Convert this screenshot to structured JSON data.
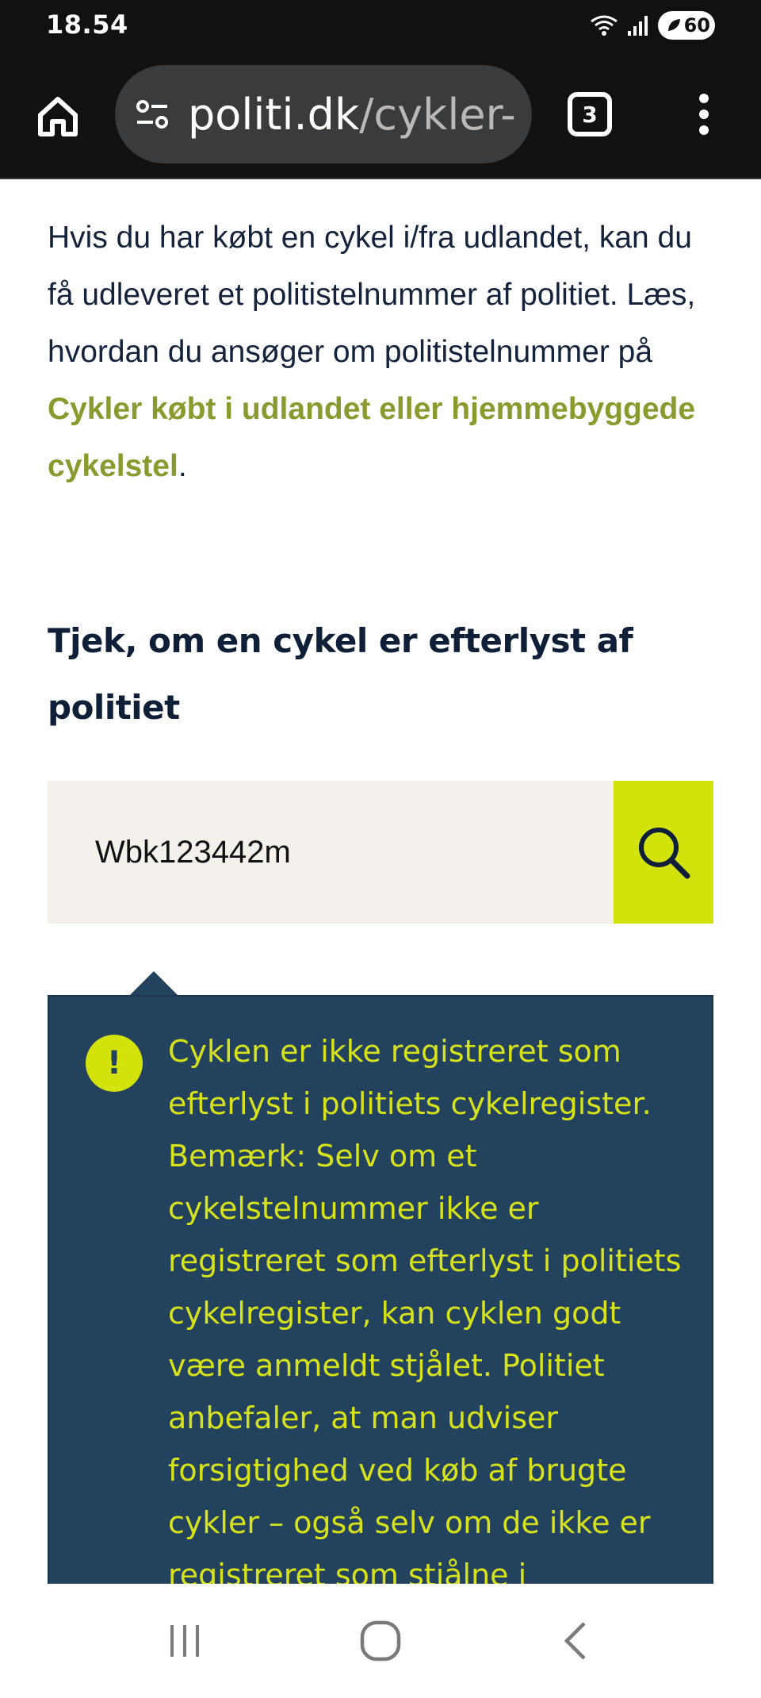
{
  "status_bar": {
    "time": "18.54",
    "battery_level": "60"
  },
  "browser": {
    "url_domain": "politi.dk",
    "url_path": "/cykler-",
    "tab_count": "3"
  },
  "content": {
    "intro_text": "Hvis du har købt en cykel i/fra udlandet, kan du få udleveret et politistelnummer af politiet. Læs, hvordan du ansøger om politistelnummer på ",
    "intro_link": "Cykler købt i udlandet eller hjemmebyggede cykelstel",
    "intro_end": ".",
    "section_title": "Tjek, om en cykel er efterlyst af politiet",
    "search_value": "Wbk123442m",
    "alert_icon_symbol": "!",
    "alert_text": "Cyklen er ikke registreret som efterlyst i politiets cykelregister. Bemærk: Selv om et cykelstelnummer ikke er registreret som efterlyst i politiets cykelregister, kan cyklen godt være anmeldt stjålet. Politiet anbefaler, at man udviser forsigtighed ved køb af brugte cykler – også selv om de ikke er registreret som stjålne i"
  },
  "colors": {
    "link": "#8a9a2e",
    "accent": "#d4e20b",
    "alert_bg": "#23425e",
    "alert_text": "#d7e21a"
  },
  "icons": {
    "home": "home-icon",
    "site_info": "tune-icon",
    "search": "search-icon",
    "alert": "exclamation-icon",
    "menu": "more-vert-icon",
    "nav_recents": "recents-icon",
    "nav_home": "nav-home-icon",
    "nav_back": "back-icon"
  }
}
